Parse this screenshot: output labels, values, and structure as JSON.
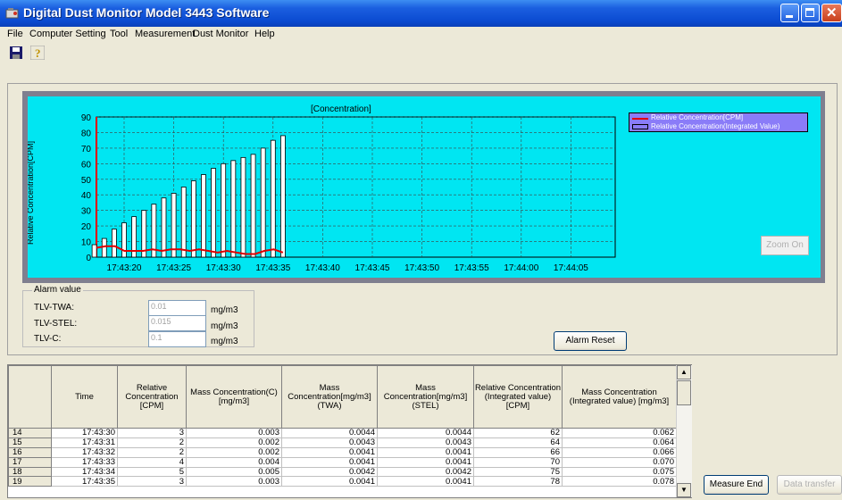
{
  "window": {
    "title": "Digital Dust Monitor Model 3443 Software"
  },
  "menu": [
    "File",
    "Computer Setting",
    "Tool",
    "Measurement",
    "Dust Monitor",
    "Help"
  ],
  "toolbar": {
    "save_icon": "floppy-disk-icon",
    "help_icon": "question-mark-icon"
  },
  "chart_data": {
    "type": "bar",
    "title": "[Concentration]",
    "ylabel": "Relative Concentration[CPM]",
    "ylim": [
      0,
      90
    ],
    "yticks": [
      0,
      10,
      20,
      30,
      40,
      50,
      60,
      70,
      80,
      90
    ],
    "xticks": [
      "17:43:20",
      "17:43:25",
      "17:43:30",
      "17:43:35",
      "17:43:40",
      "17:43:45",
      "17:43:50",
      "17:43:55",
      "17:44:00",
      "17:44:05"
    ],
    "grid": true,
    "legend_position": "top-right",
    "series": [
      {
        "name": "Relative Concentration[CPM]",
        "type": "line",
        "color": "#e00000",
        "values": [
          6,
          7,
          7,
          4,
          4,
          4,
          5,
          4,
          5,
          5,
          4,
          5,
          4,
          3,
          4,
          3,
          2,
          2,
          4,
          5,
          3
        ]
      },
      {
        "name": "Relative Concentration(Integrated Value)",
        "type": "bar",
        "color": "#ffffff",
        "values": [
          8,
          12,
          18,
          22,
          26,
          30,
          34,
          38,
          41,
          45,
          49,
          53,
          57,
          60,
          62,
          64,
          66,
          70,
          75,
          78
        ]
      }
    ]
  },
  "zoom_button": "Zoom On",
  "alarm": {
    "title": "Alarm value",
    "unit": "mg/m3",
    "rows": [
      {
        "label": "TLV-TWA:",
        "value": "0.01"
      },
      {
        "label": "TLV-STEL:",
        "value": "0.015"
      },
      {
        "label": "TLV-C:",
        "value": "0.1"
      }
    ],
    "reset_label": "Alarm Reset"
  },
  "table": {
    "headers": [
      "",
      "Time",
      "Relative Concentration [CPM]",
      "Mass Concentration(C) [mg/m3]",
      "Mass Concentration[mg/m3] (TWA)",
      "Mass Concentration[mg/m3] (STEL)",
      "Relative Concentration (Integrated value) [CPM]",
      "Mass Concentration (Integrated value) [mg/m3]"
    ],
    "rows": [
      [
        "14",
        "17:43:30",
        "3",
        "0.003",
        "0.0044",
        "0.0044",
        "62",
        "0.062"
      ],
      [
        "15",
        "17:43:31",
        "2",
        "0.002",
        "0.0043",
        "0.0043",
        "64",
        "0.064"
      ],
      [
        "16",
        "17:43:32",
        "2",
        "0.002",
        "0.0041",
        "0.0041",
        "66",
        "0.066"
      ],
      [
        "17",
        "17:43:33",
        "4",
        "0.004",
        "0.0041",
        "0.0041",
        "70",
        "0.070"
      ],
      [
        "18",
        "17:43:34",
        "5",
        "0.005",
        "0.0042",
        "0.0042",
        "75",
        "0.075"
      ],
      [
        "19",
        "17:43:35",
        "3",
        "0.003",
        "0.0041",
        "0.0041",
        "78",
        "0.078"
      ]
    ]
  },
  "buttons": {
    "measure_end": "Measure End",
    "data_transfer": "Data transfer"
  }
}
